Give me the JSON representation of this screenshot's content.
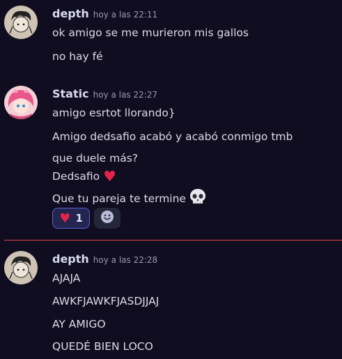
{
  "messages": [
    {
      "username": "depth",
      "timestamp": "hoy a las 22:11",
      "lines": [
        "ok amigo se me murieron mis gallos",
        "no hay fé"
      ]
    },
    {
      "username": "Static",
      "timestamp": "hoy a las 22:27",
      "lines": [
        "amigo esrtot llorando}",
        "Amigo dedsafio acabó y acabó conmigo tmb",
        "que duele más?",
        "Dedsafio",
        "Que tu pareja te termine"
      ],
      "reaction": {
        "emoji": "heart",
        "count": "1"
      }
    },
    {
      "username": "depth",
      "timestamp": "hoy a las 22:28",
      "lines": [
        "AJAJA",
        "AWKFJAWKFJASDJJAJ",
        "AY AMIGO",
        "QUEDÉ BIEN LOCO"
      ]
    }
  ],
  "colors": {
    "background": "#0f0d1f",
    "divider": "#e0474b",
    "heart": "#e0244a",
    "reaction_border": "#5b5fd9"
  },
  "icons": [
    "heart-icon",
    "skull-icon",
    "add-reaction-icon"
  ]
}
